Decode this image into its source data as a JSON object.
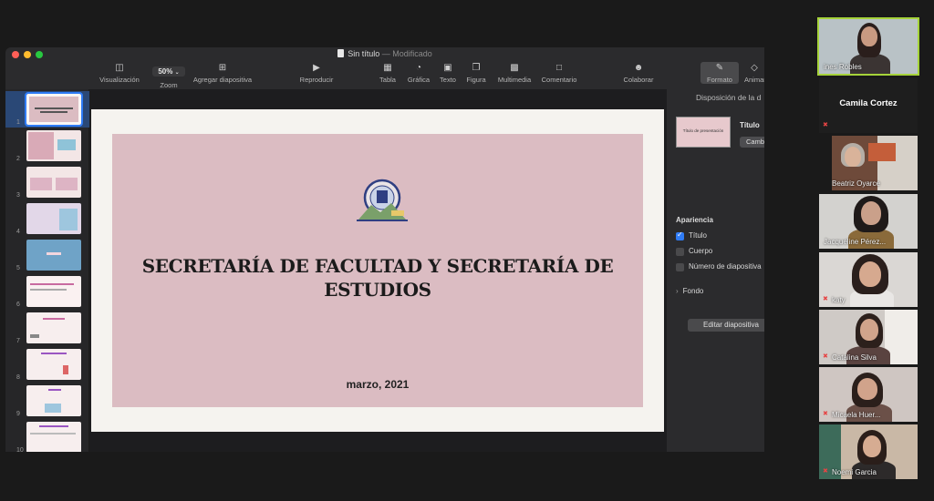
{
  "window": {
    "title": "Sin título",
    "modified": "— Modificado"
  },
  "toolbar": {
    "visualizacion": "Visualización",
    "zoom_value": "50%",
    "zoom": "Zoom",
    "agregar": "Agregar diapositiva",
    "reproducir": "Reproducir",
    "tabla": "Tabla",
    "grafica": "Gráfica",
    "texto": "Texto",
    "figura": "Figura",
    "multimedia": "Multimedia",
    "comentario": "Comentario",
    "colaborar": "Colaborar",
    "formato": "Formato",
    "animar": "Animar"
  },
  "navigator": {
    "slide_numbers": [
      "1",
      "2",
      "3",
      "4",
      "5",
      "6",
      "7",
      "8",
      "9",
      "10"
    ]
  },
  "slide": {
    "title": "SECRETARÍA DE FACULTAD Y SECRETARÍA DE ESTUDIOS",
    "date": "marzo, 2021"
  },
  "inspector": {
    "header": "Disposición de la d",
    "thumb_label": "Título de presentación",
    "title_label": "Título",
    "change_btn": "Camb",
    "apariencia": "Apariencia",
    "opt_titulo": "Título",
    "opt_cuerpo": "Cuerpo",
    "opt_numero": "Número de diapositiva",
    "fondo": "Fondo",
    "edit_btn": "Editar diapositiva"
  },
  "participants": [
    {
      "name": "ines Robles"
    },
    {
      "name": "Camila Cortez"
    },
    {
      "name": "Beatriz Oyarce"
    },
    {
      "name": "Jacqueline Pérez..."
    },
    {
      "name": "katy"
    },
    {
      "name": "Catalina Silva"
    },
    {
      "name": "Micaela Huer..."
    },
    {
      "name": "Noemi Garcia"
    }
  ],
  "colors": {
    "slide_pink": "#dbbcc2",
    "selection_blue": "#2f7cf6",
    "active_speaker": "#a6d33a",
    "muted_red": "#e64545"
  }
}
